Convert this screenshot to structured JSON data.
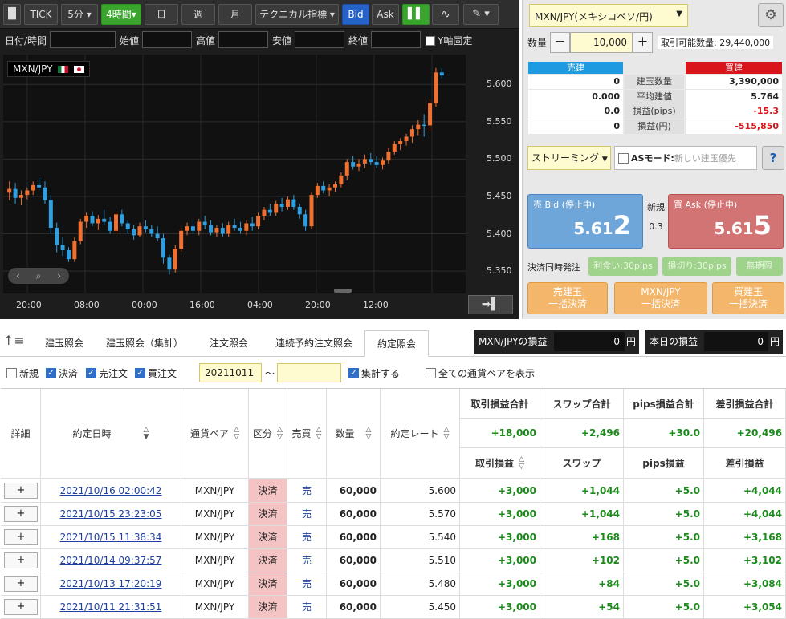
{
  "toolbar": {
    "tick": "TICK",
    "interval": "5分",
    "interval_active": "4時間",
    "day": "日",
    "week": "週",
    "month": "月",
    "technical": "テクニカル指標",
    "bid": "Bid",
    "ask": "Ask"
  },
  "ohlc": {
    "datetime": "日付/時間",
    "open": "始値",
    "high": "高値",
    "low": "安値",
    "close": "終値",
    "ylock": "Y軸固定"
  },
  "chart": {
    "pair": "MXN/JPY",
    "yticks": [
      "5.600",
      "5.550",
      "5.500",
      "5.450",
      "5.400",
      "5.350"
    ],
    "yvalues": [
      5.6,
      5.55,
      5.5,
      5.45,
      5.4,
      5.35
    ],
    "xticks": [
      "20:00",
      "08:00",
      "00:00",
      "16:00",
      "04:00",
      "20:00",
      "12:00"
    ],
    "candles": [
      [
        5.455,
        5.47,
        5.445,
        5.46
      ],
      [
        5.46,
        5.468,
        5.44,
        5.448
      ],
      [
        5.448,
        5.458,
        5.438,
        5.452
      ],
      [
        5.452,
        5.462,
        5.446,
        5.458
      ],
      [
        5.458,
        5.47,
        5.452,
        5.465
      ],
      [
        5.465,
        5.475,
        5.458,
        5.462
      ],
      [
        5.462,
        5.47,
        5.44,
        5.445
      ],
      [
        5.445,
        5.452,
        5.4,
        5.408
      ],
      [
        5.408,
        5.415,
        5.375,
        5.385
      ],
      [
        5.385,
        5.395,
        5.37,
        5.378
      ],
      [
        5.378,
        5.382,
        5.362,
        5.366
      ],
      [
        5.366,
        5.395,
        5.362,
        5.39
      ],
      [
        5.39,
        5.42,
        5.386,
        5.416
      ],
      [
        5.416,
        5.428,
        5.408,
        5.424
      ],
      [
        5.424,
        5.43,
        5.41,
        5.414
      ],
      [
        5.414,
        5.425,
        5.405,
        5.42
      ],
      [
        5.42,
        5.432,
        5.412,
        5.416
      ],
      [
        5.416,
        5.422,
        5.4,
        5.404
      ],
      [
        5.404,
        5.43,
        5.4,
        5.426
      ],
      [
        5.426,
        5.432,
        5.41,
        5.414
      ],
      [
        5.414,
        5.418,
        5.4,
        5.406
      ],
      [
        5.406,
        5.412,
        5.392,
        5.398
      ],
      [
        5.398,
        5.415,
        5.395,
        5.41
      ],
      [
        5.41,
        5.418,
        5.402,
        5.406
      ],
      [
        5.406,
        5.412,
        5.396,
        5.4
      ],
      [
        5.4,
        5.41,
        5.39,
        5.394
      ],
      [
        5.394,
        5.4,
        5.36,
        5.368
      ],
      [
        5.368,
        5.372,
        5.345,
        5.352
      ],
      [
        5.352,
        5.385,
        5.348,
        5.38
      ],
      [
        5.38,
        5.408,
        5.376,
        5.404
      ],
      [
        5.404,
        5.415,
        5.398,
        5.41
      ],
      [
        5.41,
        5.418,
        5.4,
        5.404
      ],
      [
        5.404,
        5.42,
        5.398,
        5.416
      ],
      [
        5.416,
        5.424,
        5.406,
        5.412
      ],
      [
        5.412,
        5.418,
        5.398,
        5.402
      ],
      [
        5.402,
        5.412,
        5.396,
        5.408
      ],
      [
        5.408,
        5.414,
        5.396,
        5.4
      ],
      [
        5.4,
        5.416,
        5.396,
        5.412
      ],
      [
        5.412,
        5.42,
        5.404,
        5.408
      ],
      [
        5.408,
        5.416,
        5.4,
        5.404
      ],
      [
        5.404,
        5.418,
        5.398,
        5.414
      ],
      [
        5.414,
        5.422,
        5.404,
        5.41
      ],
      [
        5.41,
        5.428,
        5.406,
        5.424
      ],
      [
        5.424,
        5.436,
        5.418,
        5.432
      ],
      [
        5.432,
        5.44,
        5.424,
        5.428
      ],
      [
        5.428,
        5.444,
        5.424,
        5.44
      ],
      [
        5.44,
        5.448,
        5.43,
        5.436
      ],
      [
        5.436,
        5.45,
        5.432,
        5.446
      ],
      [
        5.446,
        5.452,
        5.432,
        5.436
      ],
      [
        5.436,
        5.44,
        5.42,
        5.426
      ],
      [
        5.426,
        5.432,
        5.404,
        5.41
      ],
      [
        5.41,
        5.455,
        5.406,
        5.452
      ],
      [
        5.452,
        5.468,
        5.448,
        5.464
      ],
      [
        5.464,
        5.47,
        5.454,
        5.458
      ],
      [
        5.458,
        5.466,
        5.45,
        5.462
      ],
      [
        5.462,
        5.47,
        5.456,
        5.466
      ],
      [
        5.466,
        5.482,
        5.462,
        5.478
      ],
      [
        5.478,
        5.5,
        5.472,
        5.496
      ],
      [
        5.496,
        5.504,
        5.486,
        5.49
      ],
      [
        5.49,
        5.5,
        5.484,
        5.494
      ],
      [
        5.494,
        5.506,
        5.488,
        5.5
      ],
      [
        5.5,
        5.508,
        5.492,
        5.496
      ],
      [
        5.496,
        5.504,
        5.488,
        5.492
      ],
      [
        5.492,
        5.502,
        5.486,
        5.498
      ],
      [
        5.498,
        5.515,
        5.494,
        5.51
      ],
      [
        5.51,
        5.524,
        5.506,
        5.52
      ],
      [
        5.52,
        5.528,
        5.512,
        5.524
      ],
      [
        5.524,
        5.534,
        5.518,
        5.53
      ],
      [
        5.53,
        5.545,
        5.522,
        5.54
      ],
      [
        5.54,
        5.552,
        5.532,
        5.546
      ],
      [
        5.546,
        5.56,
        5.53,
        5.545
      ],
      [
        5.545,
        5.58,
        5.538,
        5.575
      ],
      [
        5.575,
        5.622,
        5.57,
        5.616
      ],
      [
        5.616,
        5.622,
        5.608,
        5.612
      ]
    ]
  },
  "order": {
    "pair": "MXN/JPY(メキシコペソ/円)",
    "qty_label": "数量",
    "minus": "－",
    "qty": "10,000",
    "plus": "＋",
    "available": "取引可能数量: 29,440,000",
    "sell_header": "売建",
    "buy_header": "買建",
    "rows": [
      {
        "label": "建玉数量",
        "sell": "0",
        "buy": "3,390,000",
        "buy_red": false
      },
      {
        "label": "平均建値",
        "sell": "0.000",
        "buy": "5.764",
        "buy_red": false
      },
      {
        "label": "損益(pips)",
        "sell": "0.0",
        "buy": "-15.3",
        "buy_red": true
      },
      {
        "label": "損益(円)",
        "sell": "0",
        "buy": "-515,850",
        "buy_red": true
      }
    ],
    "streaming": "ストリーミング",
    "as_mode": "ASモード:",
    "as_mode_text": "新しい建玉優先",
    "help": "?",
    "bid_label": "売 Bid (停止中)",
    "bid_big": "5.61",
    "bid_small": "2",
    "new_label": "新規",
    "spread": "0.3",
    "ask_label": "買 Ask (停止中)",
    "ask_big": "5.61",
    "ask_small": "5",
    "settle_label": "決済同時発注",
    "profit": "利食い:30pips",
    "loss": "損切り:30pips",
    "unlimited": "無期限",
    "bulk_sell": [
      "売建玉",
      "一括決済"
    ],
    "bulk_pair": [
      "MXN/JPY",
      "一括決済"
    ],
    "bulk_buy": [
      "買建玉",
      "一括決済"
    ]
  },
  "tabs": [
    "建玉照会",
    "建玉照会（集計）",
    "注文照会",
    "連続予約注文照会",
    "約定照会"
  ],
  "pl": {
    "pair_label": "MXN/JPYの損益",
    "pair_value": "0",
    "unit": "円",
    "today_label": "本日の損益",
    "today_value": "0"
  },
  "filter": {
    "new": "新規",
    "settle": "決済",
    "sell": "売注文",
    "buy": "買注文",
    "date_from": "20211011",
    "tilde": "〜",
    "date_to": "",
    "aggregate": "集計する",
    "all_pairs": "全ての通貨ペアを表示"
  },
  "grid": {
    "headers": {
      "detail": "詳細",
      "date": "約定日時",
      "pair": "通貨ペア",
      "type": "区分",
      "side": "売買",
      "qty": "数量",
      "rate": "約定レート"
    },
    "sum_headers": [
      "取引損益合計",
      "スワップ合計",
      "pips損益合計",
      "差引損益合計"
    ],
    "sums": [
      "+18,000",
      "+2,496",
      "+30.0",
      "+20,496"
    ],
    "sub_headers": [
      "取引損益",
      "スワップ",
      "pips損益",
      "差引損益"
    ],
    "rows": [
      {
        "date": "2021/10/16 02:00:42",
        "pair": "MXN/JPY",
        "type": "決済",
        "side": "売",
        "qty": "60,000",
        "rate": "5.600",
        "pl": "+3,000",
        "swap": "+1,044",
        "pips": "+5.0",
        "net": "+4,044"
      },
      {
        "date": "2021/10/15 23:23:05",
        "pair": "MXN/JPY",
        "type": "決済",
        "side": "売",
        "qty": "60,000",
        "rate": "5.570",
        "pl": "+3,000",
        "swap": "+1,044",
        "pips": "+5.0",
        "net": "+4,044"
      },
      {
        "date": "2021/10/15 11:38:34",
        "pair": "MXN/JPY",
        "type": "決済",
        "side": "売",
        "qty": "60,000",
        "rate": "5.540",
        "pl": "+3,000",
        "swap": "+168",
        "pips": "+5.0",
        "net": "+3,168"
      },
      {
        "date": "2021/10/14 09:37:57",
        "pair": "MXN/JPY",
        "type": "決済",
        "side": "売",
        "qty": "60,000",
        "rate": "5.510",
        "pl": "+3,000",
        "swap": "+102",
        "pips": "+5.0",
        "net": "+3,102"
      },
      {
        "date": "2021/10/13 17:20:19",
        "pair": "MXN/JPY",
        "type": "決済",
        "side": "売",
        "qty": "60,000",
        "rate": "5.480",
        "pl": "+3,000",
        "swap": "+84",
        "pips": "+5.0",
        "net": "+3,084"
      },
      {
        "date": "2021/10/11 21:31:51",
        "pair": "MXN/JPY",
        "type": "決済",
        "side": "売",
        "qty": "60,000",
        "rate": "5.450",
        "pl": "+3,000",
        "swap": "+54",
        "pips": "+5.0",
        "net": "+3,054"
      }
    ]
  }
}
